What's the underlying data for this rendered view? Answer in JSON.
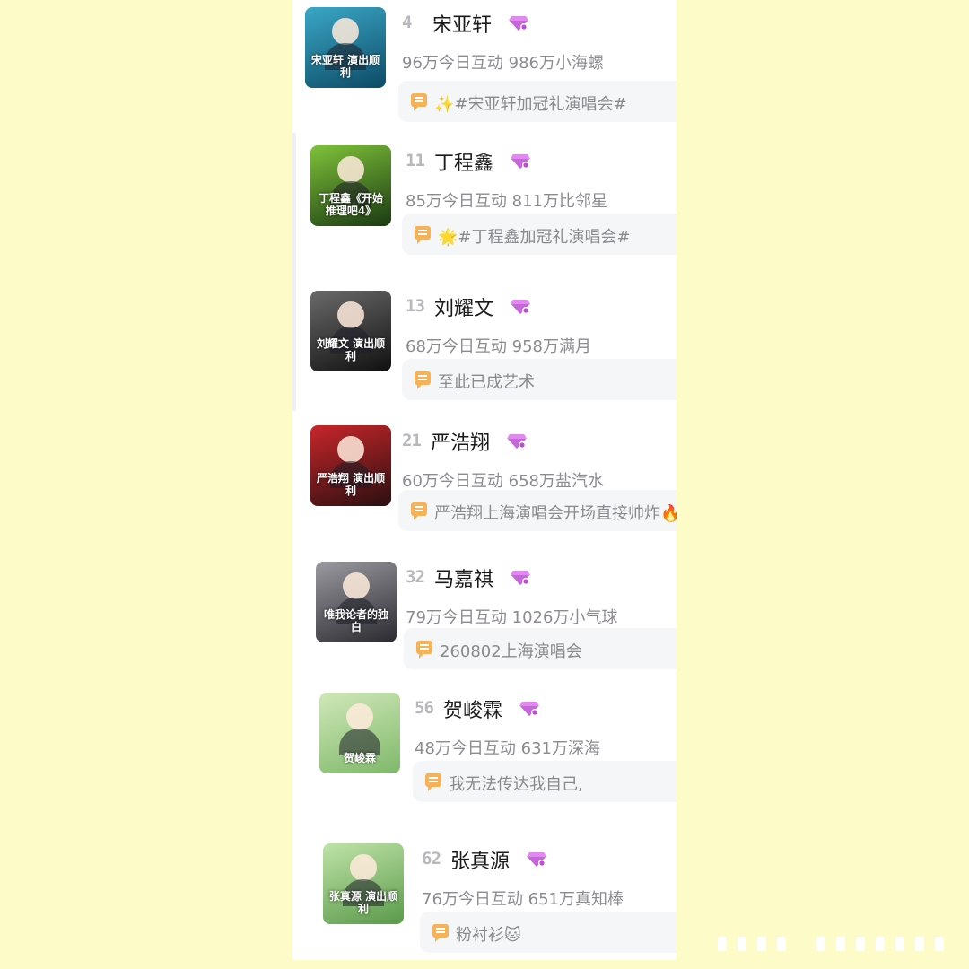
{
  "colors": {
    "background": "#fdfcc8",
    "panel": "#ffffff",
    "diamond": "#c04ad6",
    "comment_icon": "#f5b256"
  },
  "items": [
    {
      "rank": "4",
      "name": "宋亚轩",
      "stats": "96万今日互动 986万小海螺",
      "comment": "✨#宋亚轩加冠礼演唱会#",
      "cover_caption": "宋亚轩 演出顺利",
      "cover_colors": [
        "#3aa7c6",
        "#0d4b66"
      ],
      "badge_icon": "diamond-icon"
    },
    {
      "rank": "11",
      "name": "丁程鑫",
      "stats": "85万今日互动 811万比邻星",
      "comment": "🌟#丁程鑫加冠礼演唱会#",
      "cover_caption": "丁程鑫《开始推理吧4》",
      "cover_colors": [
        "#7fc23a",
        "#1a3a12"
      ],
      "badge_icon": "diamond-icon"
    },
    {
      "rank": "13",
      "name": "刘耀文",
      "stats": "68万今日互动 958万满月",
      "comment": "至此已成艺术",
      "cover_caption": "刘耀文 演出顺利",
      "cover_colors": [
        "#6a6a6a",
        "#101010"
      ],
      "badge_icon": "diamond-icon"
    },
    {
      "rank": "21",
      "name": "严浩翔",
      "stats": "60万今日互动 658万盐汽水",
      "comment": "严浩翔上海演唱会开场直接帅炸🔥",
      "cover_caption": "严浩翔 演出顺利",
      "cover_colors": [
        "#c8262a",
        "#2a0f10"
      ],
      "badge_icon": "diamond-icon"
    },
    {
      "rank": "32",
      "name": "马嘉祺",
      "stats": "79万今日互动 1026万小气球",
      "comment": "260802上海演唱会",
      "cover_caption": "唯我论者的独白",
      "cover_colors": [
        "#9a9aa0",
        "#2a2a30"
      ],
      "badge_icon": "diamond-icon"
    },
    {
      "rank": "56",
      "name": "贺峻霖",
      "stats": "48万今日互动 631万深海",
      "comment": "我无法传达我自己,",
      "cover_caption": "贺峻霖",
      "cover_colors": [
        "#cfe8b8",
        "#7fb86a"
      ],
      "badge_icon": "diamond-icon"
    },
    {
      "rank": "62",
      "name": "张真源",
      "stats": "76万今日互动 651万真知棒",
      "comment": "粉衬衫🐱",
      "cover_caption": "张真源 演出顺利",
      "cover_colors": [
        "#bfe3a8",
        "#5a9a4a"
      ],
      "badge_icon": "diamond-icon"
    }
  ]
}
